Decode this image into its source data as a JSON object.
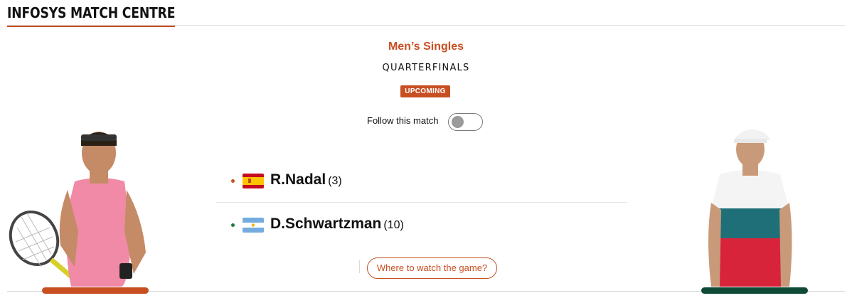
{
  "header": {
    "title": "INFOSYS MATCH CENTRE"
  },
  "match": {
    "event": "Men’s Singles",
    "round": "QUARTERFINALS",
    "status": "UPCOMING"
  },
  "follow": {
    "label": "Follow this match",
    "enabled": false
  },
  "players": [
    {
      "name": "R.Nadal",
      "seed": "(3)",
      "country": "Spain",
      "flag_icon": "spain-flag-icon",
      "dot_color": "#c84f22"
    },
    {
      "name": "D.Schwartzman",
      "seed": "(10)",
      "country": "Argentina",
      "flag_icon": "argentina-flag-icon",
      "dot_color": "#1e7a3d"
    }
  ],
  "watch": {
    "label": "Where to watch the game?"
  },
  "colors": {
    "accent": "#c84f22",
    "player1": "#c84f22",
    "player2": "#0e4a35"
  }
}
